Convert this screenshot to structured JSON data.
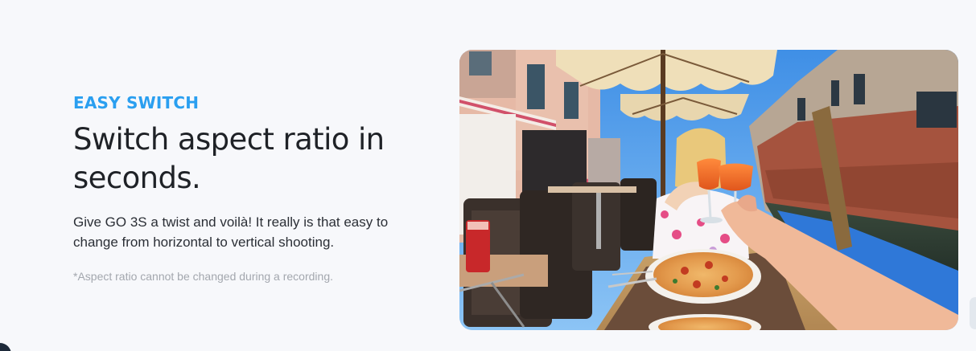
{
  "feature": {
    "eyebrow": "EASY SWITCH",
    "headline": "Switch aspect ratio in seconds.",
    "body": "Give GO 3S a twist and voilà! It really is that easy to change from horizontal to vertical shooting.",
    "footnote": "*Aspect ratio cannot be changed during a recording."
  },
  "colors": {
    "accent": "#2a9ff0",
    "heading": "#1f2227",
    "body": "#2b2f36",
    "muted": "#a3a7ae",
    "background": "#f7f8fb"
  },
  "media": {
    "icon": "feature-photo"
  }
}
